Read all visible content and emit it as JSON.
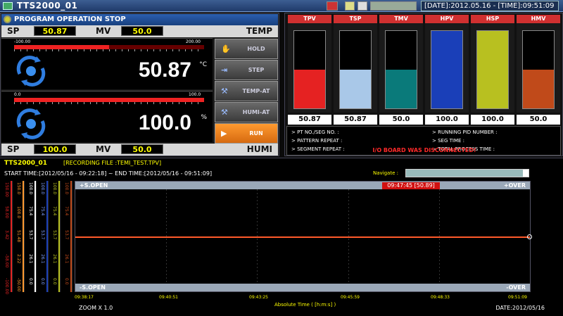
{
  "window": {
    "title": "TTS2000_01",
    "datetime": "[DATE]:2012.05.16 - [TIME]:09:51:09"
  },
  "program": {
    "status": "PROGRAM OPERATION STOP"
  },
  "temp": {
    "sp_label": "SP",
    "sp": "50.87",
    "mv_label": "MV",
    "mv": "50.0",
    "tag": "TEMP",
    "scale_min": "-100.00",
    "scale_max": "200.00",
    "value": "50.87",
    "unit": "°C",
    "level": 0.5
  },
  "humi": {
    "sp_label": "SP",
    "sp": "100.0",
    "mv_label": "MV",
    "mv": "50.0",
    "tag": "HUMI",
    "scale_min": "0.0",
    "scale_max": "100.0",
    "value": "100.0",
    "unit": "%",
    "level": 1.0
  },
  "buttons": [
    {
      "label": "HOLD",
      "icon": "hand-icon"
    },
    {
      "label": "STEP",
      "icon": "step-icon"
    },
    {
      "label": "TEMP-AT",
      "icon": "wrench-icon"
    },
    {
      "label": "HUMI-AT",
      "icon": "wrench-icon"
    },
    {
      "label": "RUN",
      "icon": "play-icon",
      "active": true
    }
  ],
  "columns": [
    {
      "name": "TPV",
      "value": "50.87",
      "color": "#e52222",
      "level": 0.5
    },
    {
      "name": "TSP",
      "value": "50.87",
      "color": "#a9c8e8",
      "level": 0.5
    },
    {
      "name": "TMV",
      "value": "50.0",
      "color": "#0a7a7a",
      "level": 0.5
    },
    {
      "name": "HPV",
      "value": "100.0",
      "color": "#1a3fb8",
      "level": 1.0
    },
    {
      "name": "HSP",
      "value": "100.0",
      "color": "#b8c020",
      "level": 1.0
    },
    {
      "name": "HMV",
      "value": "50.0",
      "color": "#c04a1a",
      "level": 0.5
    }
  ],
  "info": {
    "pt_no": "> PT NO./SEG NO. :",
    "pattern_repeat": "> PATTERN REPEAT :",
    "segment_repeat": "> SEGMENT REPEAT :",
    "running_pid": "> RUNNING PID NUMBER :",
    "seg_time": "> SEG TIME :",
    "total_time": "> TOTAL PROCESS TIME :",
    "io_message": "I/O BOARD WAS DISCONNECTED!"
  },
  "graph": {
    "title": "TTS2000_01",
    "file": "[RECORDING FILE :TEMI_TEST.TPV]",
    "time_range": "START TIME:[2012/05/16 - 09:22:18] ~ END TIME:[2012/05/16 - 09:51:09]",
    "navigate_label": "Navigate :",
    "top_left": "+S.OPEN",
    "top_right": "+OVER",
    "bottom_left": "-S.OPEN",
    "bottom_right": "-OVER",
    "cursor_readout": "09:47:45 [50.89]",
    "time_ticks": [
      "09:38:17",
      "09:40:51",
      "09:43:25",
      "09:45:59",
      "09:48:33",
      "09:51:09"
    ],
    "x_axis_label": "Absolute Time ( [h:m:s] )",
    "zoom": "ZOOM X 1.0",
    "date": "DATE:2012/05/16",
    "axes": [
      {
        "color": "#e52222",
        "labels": [
          "150.00",
          "58.00",
          "3.42",
          "-58.00",
          "-100.00"
        ]
      },
      {
        "color": "#ff9a30",
        "labels": [
          "150.0",
          "100.0",
          "51.48",
          "2.22",
          "-50.00"
        ]
      },
      {
        "color": "#ffffff",
        "labels": [
          "100.0",
          "75.4",
          "53.7",
          "26.1",
          "0.0"
        ]
      },
      {
        "color": "#1a3fb8",
        "labels": [
          "100.0",
          "75.4",
          "53.7",
          "26.1",
          "0.0"
        ]
      },
      {
        "color": "#b8c020",
        "labels": [
          "100.0",
          "75.4",
          "53.7",
          "26.1",
          "0.0"
        ]
      },
      {
        "color": "#c04a1a",
        "labels": [
          "100.0",
          "75.4",
          "53.7",
          "26.1",
          "0.0"
        ]
      }
    ]
  }
}
